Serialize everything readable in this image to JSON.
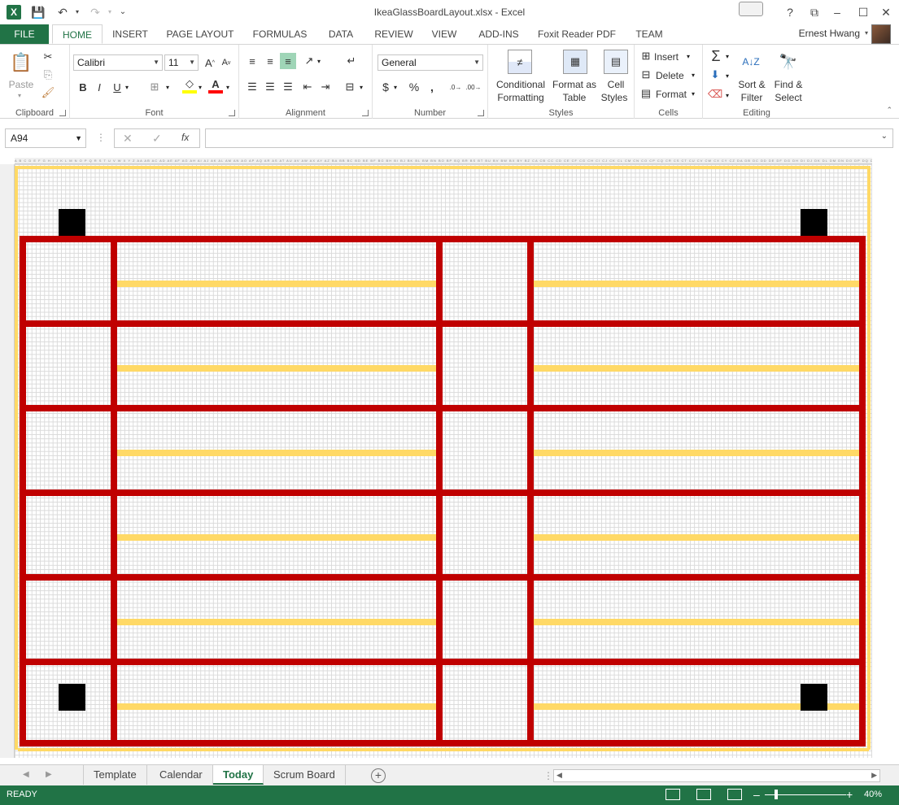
{
  "app": {
    "title": "IkeaGlassBoardLayout.xlsx - Excel",
    "logo_letter": "X"
  },
  "window_buttons": [
    "?",
    "⧉",
    "–",
    "☐",
    "✕"
  ],
  "tabs": {
    "file": "FILE",
    "items": [
      "HOME",
      "INSERT",
      "PAGE LAYOUT",
      "FORMULAS",
      "DATA",
      "REVIEW",
      "VIEW",
      "ADD-INS",
      "Foxit Reader PDF",
      "TEAM"
    ],
    "active": "HOME",
    "user": "Ernest Hwang"
  },
  "ribbon": {
    "clipboard": {
      "label": "Clipboard",
      "paste": "Paste"
    },
    "font": {
      "label": "Font",
      "name": "Calibri",
      "size": "11",
      "bold": "B",
      "italic": "I",
      "underline": "U"
    },
    "alignment": {
      "label": "Alignment"
    },
    "number": {
      "label": "Number",
      "format": "General",
      "currency": "$",
      "percent": "%",
      "comma": ","
    },
    "styles": {
      "label": "Styles",
      "conditional": "Conditional",
      "conditional2": "Formatting",
      "format_as": "Format as",
      "format_as2": "Table",
      "cell": "Cell",
      "cell2": "Styles"
    },
    "cells": {
      "label": "Cells",
      "insert": "Insert",
      "delete": "Delete",
      "format": "Format"
    },
    "editing": {
      "label": "Editing",
      "sort": "Sort &",
      "sort2": "Filter",
      "find": "Find &",
      "find2": "Select"
    }
  },
  "formula_bar": {
    "name_box": "A94",
    "fx": "fx",
    "formula": ""
  },
  "column_headers": "A B C D E F G H I J K L M N O P Q R S T U V W X Y Z AA AB AC AD AE AF AG AH AI AJ AK AL AM AN AO AP AQ AR AS AT AU AV AW AX AY AZ BA BB BC BD BE BF BG BH BI BJ BK BL BM BN BO BP BQ BR BS BT BU BV BW BX BY BZ CA CB CC CD CE CF CG CH CI CJ CK CL CM CN CO CP CQ CR CS CT CU CV CW CX CY CZ DA DB DC DD DE DF DG DH DI DJ DK DL DM DN DO DP DQ DR DS DT DU DV DW DX DY DZ EA EB EC ED EE",
  "sheet_tabs": [
    "Template",
    "Calendar",
    "Today",
    "Scrum Board"
  ],
  "active_sheet": "Today",
  "status": {
    "ready": "READY",
    "zoom": "40%"
  },
  "colors": {
    "excel_green": "#217346",
    "board_red": "#c00000",
    "stripe_yellow": "#ffd966",
    "marker_black": "#000000"
  }
}
